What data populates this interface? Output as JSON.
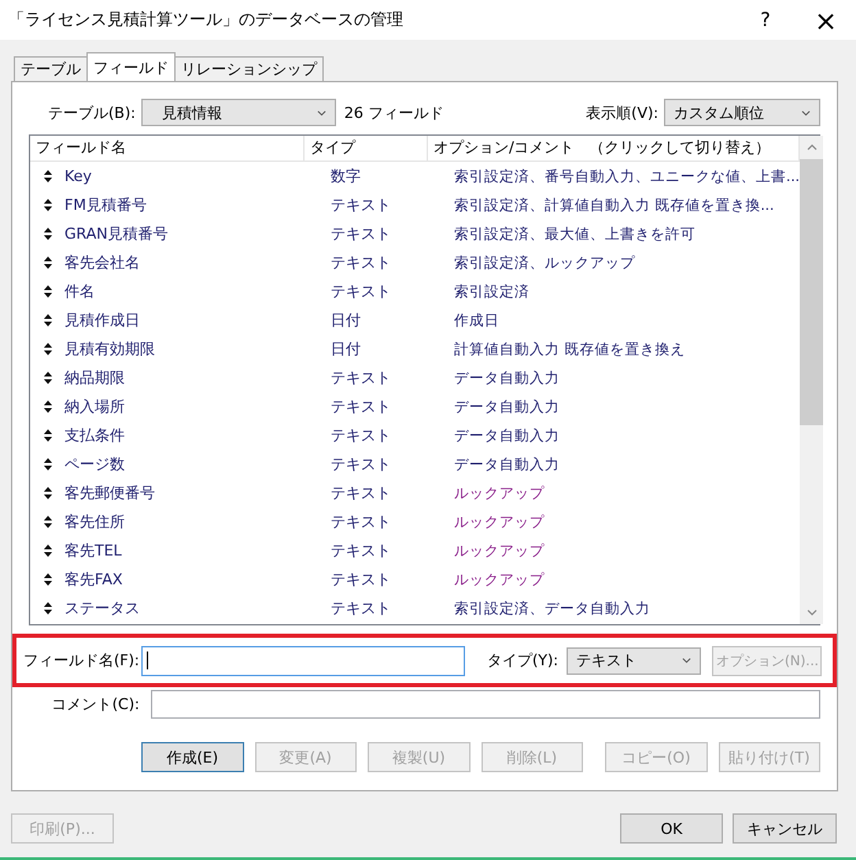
{
  "window": {
    "title": "「ライセンス見積計算ツール」のデータベースの管理",
    "help": "?",
    "close": "×"
  },
  "tabs": [
    {
      "label": "テーブル",
      "selected": false
    },
    {
      "label": "フィールド",
      "selected": true
    },
    {
      "label": "リレーションシップ",
      "selected": false
    }
  ],
  "table_select": {
    "label": "テーブル(B):",
    "value": "見積情報",
    "count": "26 フィールド"
  },
  "sort_select": {
    "label": "表示順(V):",
    "value": "カスタム順位"
  },
  "list": {
    "columns": [
      "フィールド名",
      "タイプ",
      "オプション/コメント　（クリックして切り替え）"
    ],
    "rows": [
      {
        "name": "Key",
        "type": "数字",
        "options": "索引設定済、番号自動入力、ユニークな値、上書...",
        "lookup": false
      },
      {
        "name": "FM見積番号",
        "type": "テキスト",
        "options": "索引設定済、計算値自動入力  既存値を置き換...",
        "lookup": false
      },
      {
        "name": "GRAN見積番号",
        "type": "テキスト",
        "options": "索引設定済、最大値、上書きを許可",
        "lookup": false
      },
      {
        "name": "客先会社名",
        "type": "テキスト",
        "options": "索引設定済、ルックアップ",
        "lookup": false
      },
      {
        "name": "件名",
        "type": "テキスト",
        "options": "索引設定済",
        "lookup": false
      },
      {
        "name": "見積作成日",
        "type": "日付",
        "options": "作成日",
        "lookup": false
      },
      {
        "name": "見積有効期限",
        "type": "日付",
        "options": "計算値自動入力  既存値を置き換え",
        "lookup": false
      },
      {
        "name": "納品期限",
        "type": "テキスト",
        "options": "データ自動入力",
        "lookup": false
      },
      {
        "name": "納入場所",
        "type": "テキスト",
        "options": "データ自動入力",
        "lookup": false
      },
      {
        "name": "支払条件",
        "type": "テキスト",
        "options": "データ自動入力",
        "lookup": false
      },
      {
        "name": "ページ数",
        "type": "テキスト",
        "options": "データ自動入力",
        "lookup": false
      },
      {
        "name": "客先郵便番号",
        "type": "テキスト",
        "options": "ルックアップ",
        "lookup": true
      },
      {
        "name": "客先住所",
        "type": "テキスト",
        "options": "ルックアップ",
        "lookup": true
      },
      {
        "name": "客先TEL",
        "type": "テキスト",
        "options": "ルックアップ",
        "lookup": true
      },
      {
        "name": "客先FAX",
        "type": "テキスト",
        "options": "ルックアップ",
        "lookup": true
      },
      {
        "name": "ステータス",
        "type": "テキスト",
        "options": "索引設定済、データ自動入力",
        "lookup": false
      }
    ]
  },
  "field_name": {
    "label": "フィールド名(F):"
  },
  "field_type": {
    "label": "タイプ(Y):",
    "value": "テキスト"
  },
  "options_button": {
    "label": "オプション(N)...",
    "disabled": true
  },
  "comment": {
    "label": "コメント(C):"
  },
  "actions": [
    {
      "label": "作成(E)",
      "disabled": false
    },
    {
      "label": "変更(A)",
      "disabled": true
    },
    {
      "label": "複製(U)",
      "disabled": true
    },
    {
      "label": "削除(L)",
      "disabled": true
    },
    {
      "label": "コピー(O)",
      "disabled": true
    },
    {
      "label": "貼り付け(T)",
      "disabled": true
    }
  ],
  "print_button": {
    "label": "印刷(P)...",
    "disabled": true
  },
  "footer_buttons": [
    "OK",
    "キャンセル"
  ]
}
